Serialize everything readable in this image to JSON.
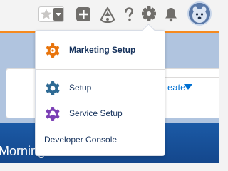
{
  "header": {
    "favorite_icon": "star-icon",
    "favorites_menu_icon": "chevron-down-icon",
    "global_actions_icon": "plus-icon",
    "trailhead_icon": "trailhead-icon",
    "help_icon": "help-icon",
    "setup_icon": "gear-icon",
    "notifications_icon": "bell-icon",
    "avatar_icon": "avatar-icon"
  },
  "setup_menu": {
    "items": [
      {
        "label": "Marketing Setup",
        "icon": "marketing-setup-icon",
        "color": "#e8740c",
        "bold": true
      },
      {
        "label": "Setup",
        "icon": "setup-gear-icon",
        "color": "#2e6a94",
        "bold": false
      },
      {
        "label": "Service Setup",
        "icon": "service-setup-icon",
        "color": "#7b3fb5",
        "bold": false
      }
    ],
    "developer_console": "Developer Console"
  },
  "background": {
    "create_label": "eate",
    "greeting": "Morning!"
  },
  "colors": {
    "accent_line": "#f58a1f",
    "link_blue": "#0070d2",
    "banner": "#1b5aa6",
    "header_icons": "#706e6b"
  }
}
